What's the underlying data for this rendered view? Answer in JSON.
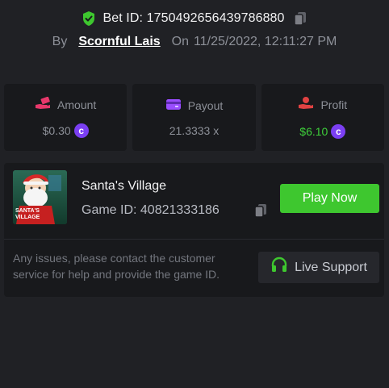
{
  "header": {
    "bet_id": "Bet ID: 1750492656439786880",
    "by_label": "By",
    "username": "Scornful Lais",
    "on_label": "On",
    "timestamp": "11/25/2022, 12:11:27 PM"
  },
  "stats": {
    "amount": {
      "label": "Amount",
      "value": "$0.30",
      "icon": "money-hand-icon"
    },
    "payout": {
      "label": "Payout",
      "value": "21.3333 x",
      "icon": "card-icon"
    },
    "profit": {
      "label": "Profit",
      "value": "$6.10",
      "icon": "profit-hand-icon"
    }
  },
  "game": {
    "title": "Santa's Village",
    "game_id": "Game ID: 40821333186",
    "play_label": "Play Now",
    "thumbnail_logo": "SANTA'S VILLAGE"
  },
  "support": {
    "message": "Any issues, please contact the customer service for help and provide the game ID.",
    "button_label": "Live Support"
  },
  "colors": {
    "accent_green": "#3ec72f",
    "coin_purple": "#7b3ff2",
    "amount_icon": "#e8386b",
    "payout_icon": "#9a4dff",
    "profit_icon": "#e04242"
  }
}
